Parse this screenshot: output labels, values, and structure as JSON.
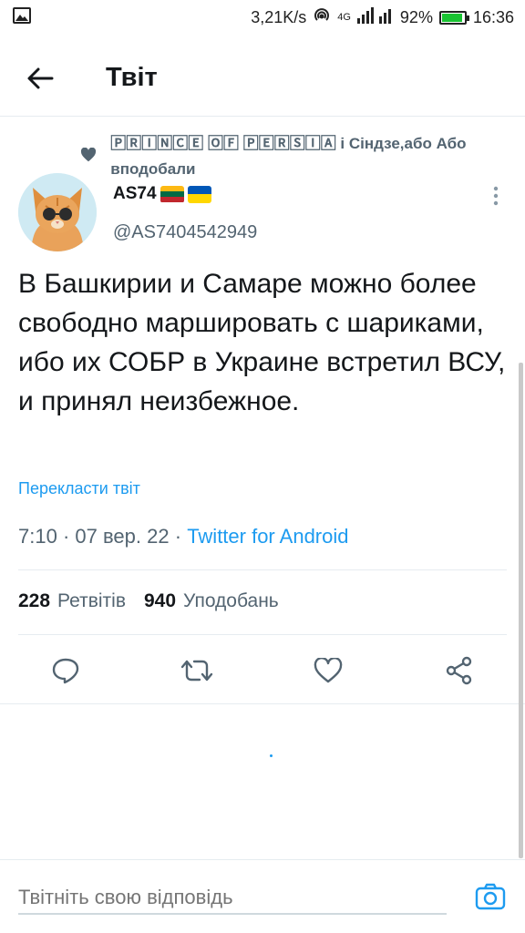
{
  "status_bar": {
    "speed": "3,21K/s",
    "network": "4G",
    "battery": "92%",
    "time": "16:36",
    "battery_level": 0.92
  },
  "app_bar": {
    "title": "Твіт"
  },
  "social_context": {
    "text": "🄿🅁🄸🄽🄲🄴 🄾🄵 🄿🄴🅁🅂🄸🄰 і Сіндзе,або Або вподобали"
  },
  "author": {
    "name": "AS74",
    "handle": "@AS7404542949",
    "flags": [
      "lithuania",
      "ukraine"
    ]
  },
  "tweet": {
    "text": "В Башкирии и Самаре можно более свободно маршировать с шариками, ибо их СОБР в Украине встретил ВСУ, и принял неизбежное.",
    "translate_label": "Перекласти твіт",
    "time": "7:10",
    "date": "07 вер. 22",
    "source": "Twitter for Android"
  },
  "stats": {
    "retweets_count": "228",
    "retweets_label": "Ретвітів",
    "likes_count": "940",
    "likes_label": "Уподобань"
  },
  "actions": {
    "reply_icon": "reply-icon",
    "retweet_icon": "retweet-icon",
    "like_icon": "heart-icon",
    "share_icon": "share-icon"
  },
  "reply_bar": {
    "placeholder": "Твітніть свою відповідь"
  },
  "colors": {
    "accent": "#1d9bf0",
    "secondary_text": "#536471",
    "divider": "#e6ecf0"
  }
}
